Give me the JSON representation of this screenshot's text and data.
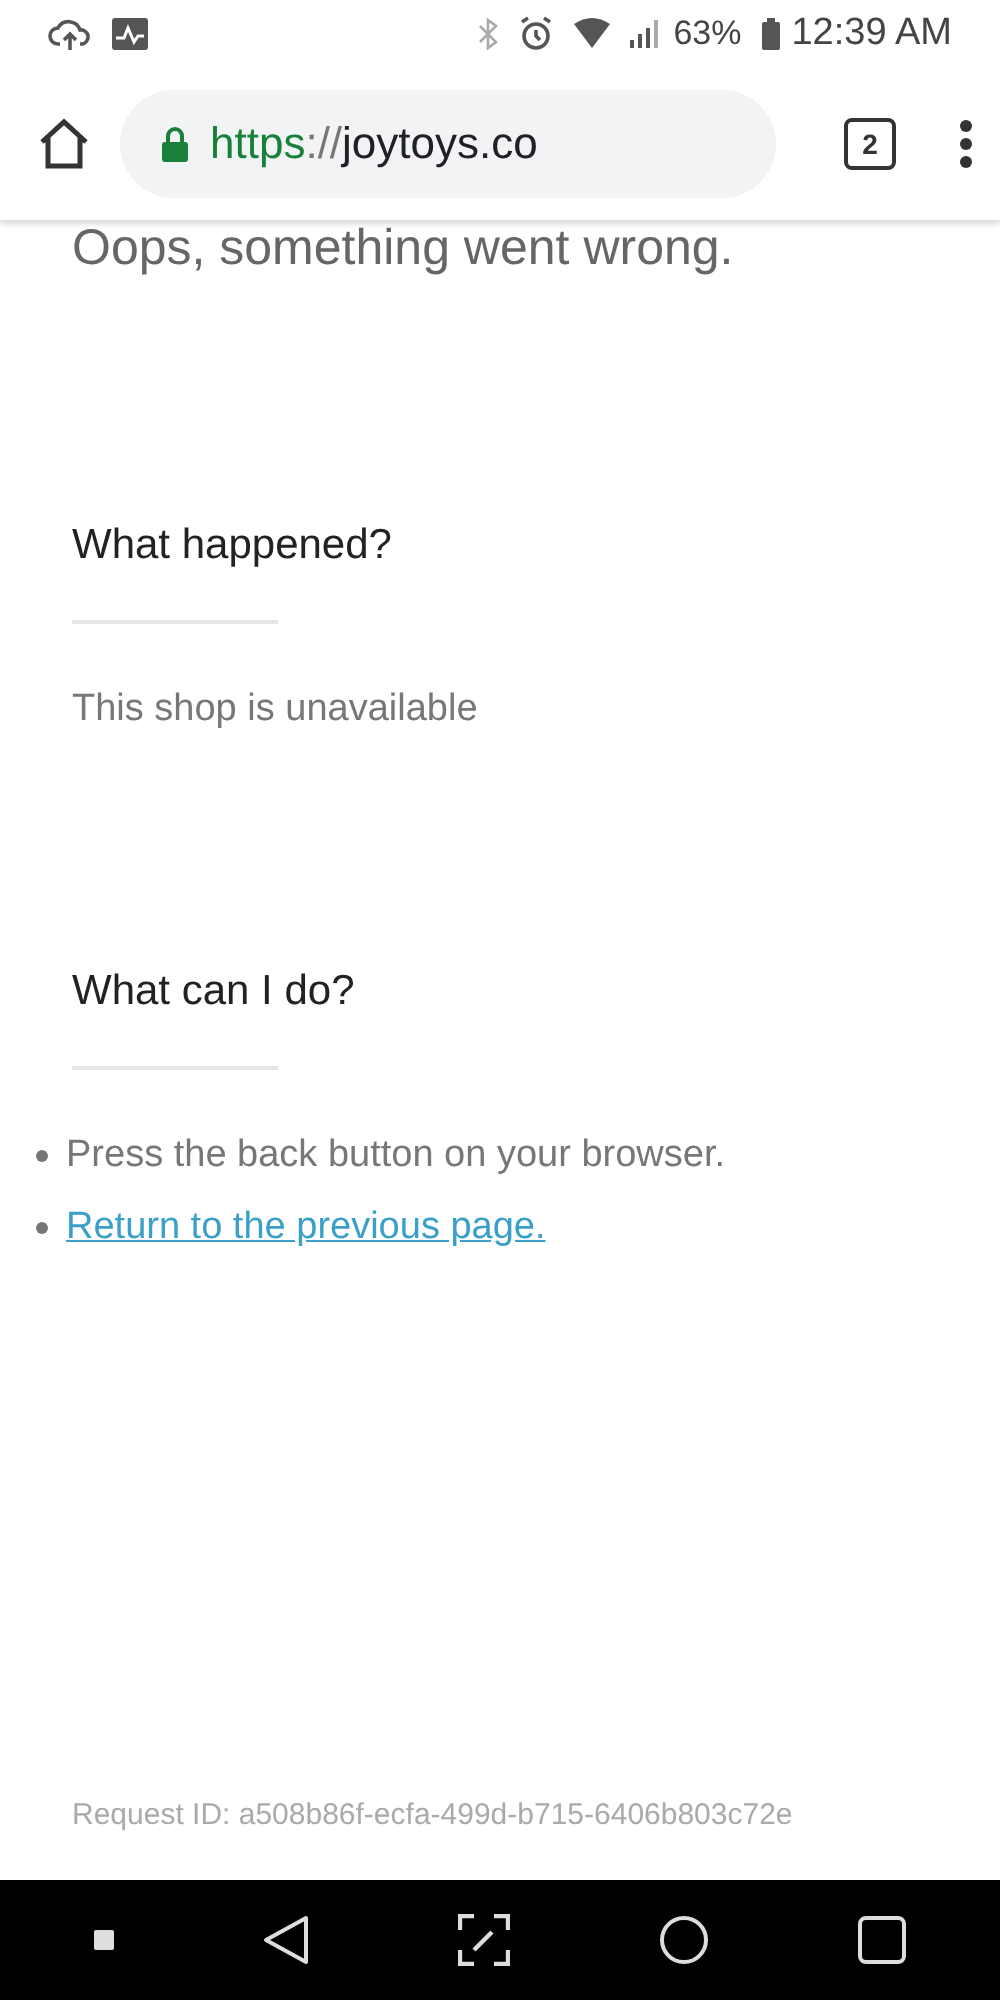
{
  "status_bar": {
    "battery": "63%",
    "time": "12:39 AM"
  },
  "browser": {
    "scheme": "https",
    "separator": "://",
    "host": "joytoys.co",
    "tab_count": "2"
  },
  "page": {
    "title": "Oops, something went wrong.",
    "sections": [
      {
        "heading": "What happened?",
        "items": [
          {
            "kind": "paragraph",
            "text": "This shop is unavailable"
          }
        ]
      },
      {
        "heading": "What can I do?",
        "items": [
          {
            "kind": "bullet",
            "text": "Press the back button on your browser."
          },
          {
            "kind": "bullet-link",
            "text": "Return to the previous page."
          }
        ]
      }
    ],
    "request_id": "Request ID: a508b86f-ecfa-499d-b715-6406b803c72e"
  }
}
